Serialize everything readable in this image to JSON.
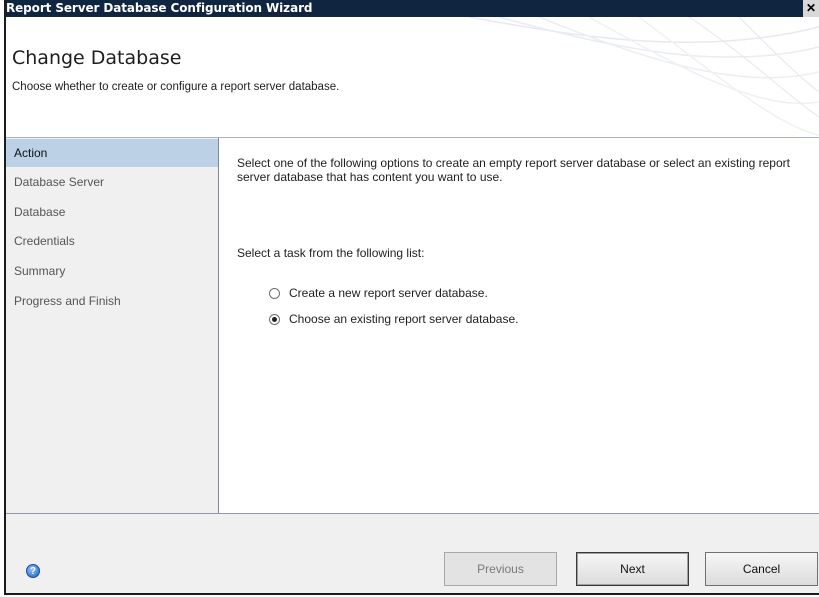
{
  "window": {
    "title": "Report Server Database Configuration Wizard",
    "close_glyph": "✕"
  },
  "header": {
    "title": "Change Database",
    "subtitle": "Choose whether to create or configure a report server database."
  },
  "nav": {
    "items": [
      {
        "label": "Action",
        "active": true
      },
      {
        "label": "Database Server"
      },
      {
        "label": "Database"
      },
      {
        "label": "Credentials"
      },
      {
        "label": "Summary"
      },
      {
        "label": "Progress and Finish"
      }
    ]
  },
  "content": {
    "intro": "Select one of the following options to create an empty report server database or select an existing report server database that has content you want to use.",
    "task_label": "Select a task from the following list:",
    "options": [
      {
        "label": "Create a new report server database.",
        "selected": false
      },
      {
        "label": "Choose an existing report server database.",
        "selected": true
      }
    ]
  },
  "footer": {
    "help_icon": "help-icon",
    "previous_label": "Previous",
    "next_label": "Next",
    "cancel_label": "Cancel"
  },
  "colors": {
    "titlebar": "#10253f",
    "nav_active": "#bcd0e6"
  }
}
